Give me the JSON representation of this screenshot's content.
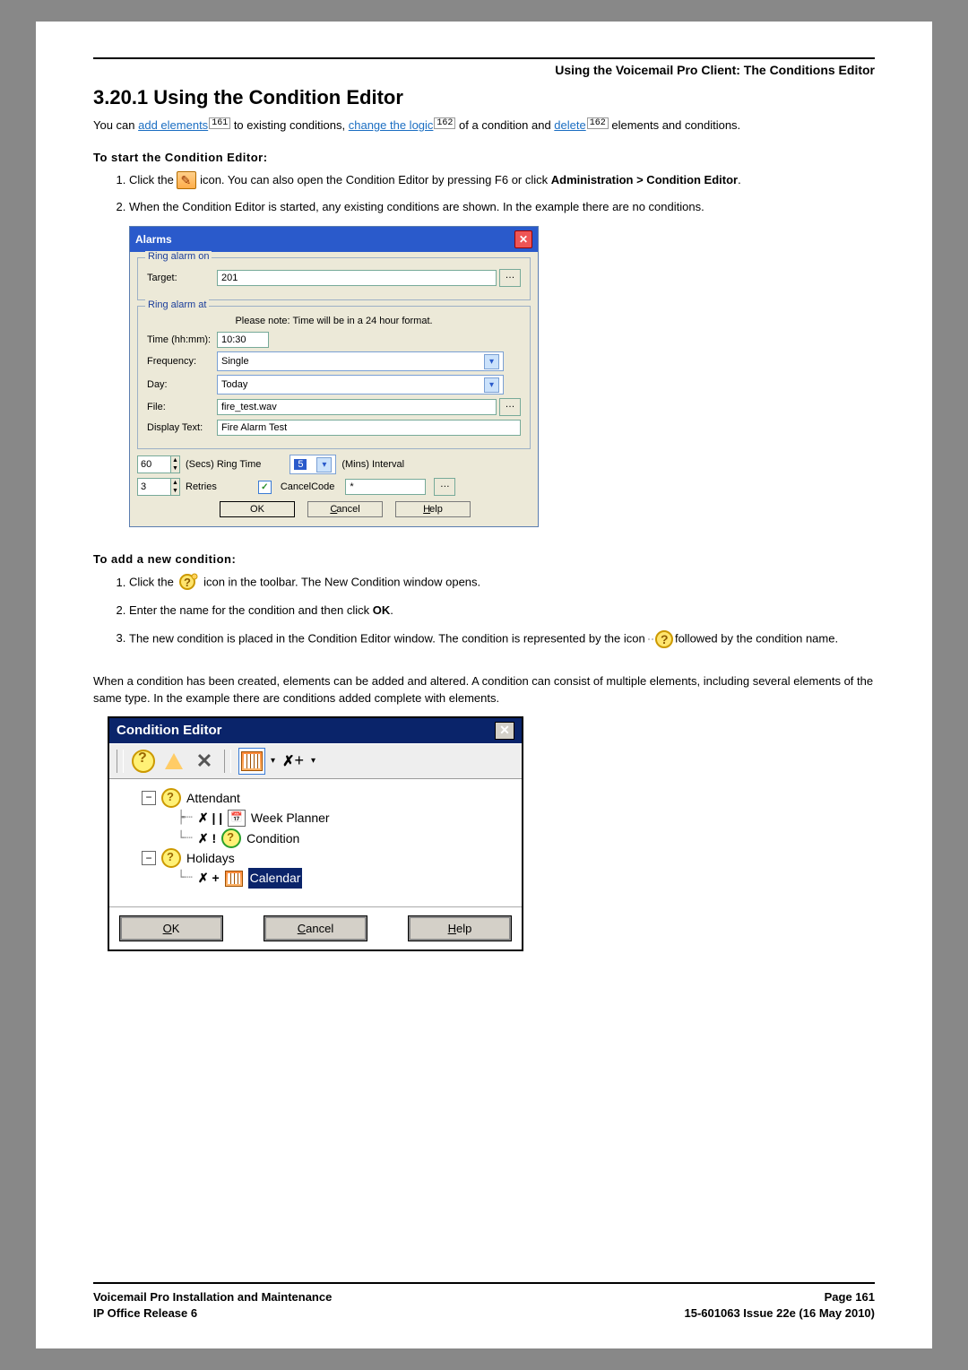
{
  "header": {
    "text": "Using the Voicemail Pro Client: The Conditions Editor"
  },
  "h1": "3.20.1 Using the Condition Editor",
  "intro": {
    "t1": "You can ",
    "link_add": "add elements",
    "ref1": "161",
    "t2": " to existing conditions, ",
    "link_change": "change the logic",
    "ref2": "162",
    "t3": " of a condition and ",
    "link_delete": "delete",
    "ref3": "162",
    "t4": " elements and conditions."
  },
  "subhead_start": "To start the Condition Editor:",
  "start_steps": {
    "s1a": "Click the ",
    "s1b": " icon. You can also open the Condition Editor by pressing F6 or click ",
    "s1_bold1": "Administration > Condition Editor",
    "s1c": ".",
    "s2": "When the Condition Editor is started, any existing conditions are shown. In the example there are no conditions."
  },
  "alarms": {
    "title": "Alarms",
    "grp1_title": "Ring alarm on",
    "target_label": "Target:",
    "target_value": "201",
    "grp2_title": "Ring alarm at",
    "note": "Please note: Time will be in a 24 hour format.",
    "time_label": "Time (hh:mm):",
    "time_value": "10:30",
    "freq_label": "Frequency:",
    "freq_value": "Single",
    "day_label": "Day:",
    "day_value": "Today",
    "file_label": "File:",
    "file_value": "fire_test.wav",
    "disp_label": "Display Text:",
    "disp_value": "Fire Alarm Test",
    "secs_value": "60",
    "secs_label": "(Secs) Ring Time",
    "mins_value": "5",
    "mins_label": "(Mins) Interval",
    "retries_value": "3",
    "retries_label": "Retries",
    "cancel_code_label": "CancelCode",
    "cancel_code_value": "*",
    "ok": "OK",
    "cancel": "Cancel",
    "help": "Help"
  },
  "subhead_add": "To add a new condition:",
  "add_steps": {
    "s1a": "Click the ",
    "s1b": " icon in the toolbar. The New Condition window opens.",
    "s2": "Enter the name for the condition and then click ",
    "s2_bold": "OK",
    "s2_end": ".",
    "s3a": "The new condition is placed in the Condition Editor window. The condition is represented by the icon ",
    "s3b": " followed by the condition name."
  },
  "midpara": "When a condition has been created, elements can be added and altered. A condition can consist of multiple elements, including several elements of the same type. In the example there are conditions added complete with elements.",
  "ce": {
    "title": "Condition Editor",
    "attendant": "Attendant",
    "week": "Week Planner",
    "cond": "Condition",
    "holidays": "Holidays",
    "cal": "Calendar",
    "ok_u": "O",
    "ok_rest": "K",
    "cancel_u": "C",
    "cancel_rest": "ancel",
    "help_u": "H",
    "help_rest": "elp"
  },
  "footer": {
    "left1": "Voicemail Pro Installation and Maintenance",
    "left2": "IP Office Release 6",
    "right1": "Page 161",
    "right2": "15-601063 Issue 22e (16 May 2010)"
  }
}
